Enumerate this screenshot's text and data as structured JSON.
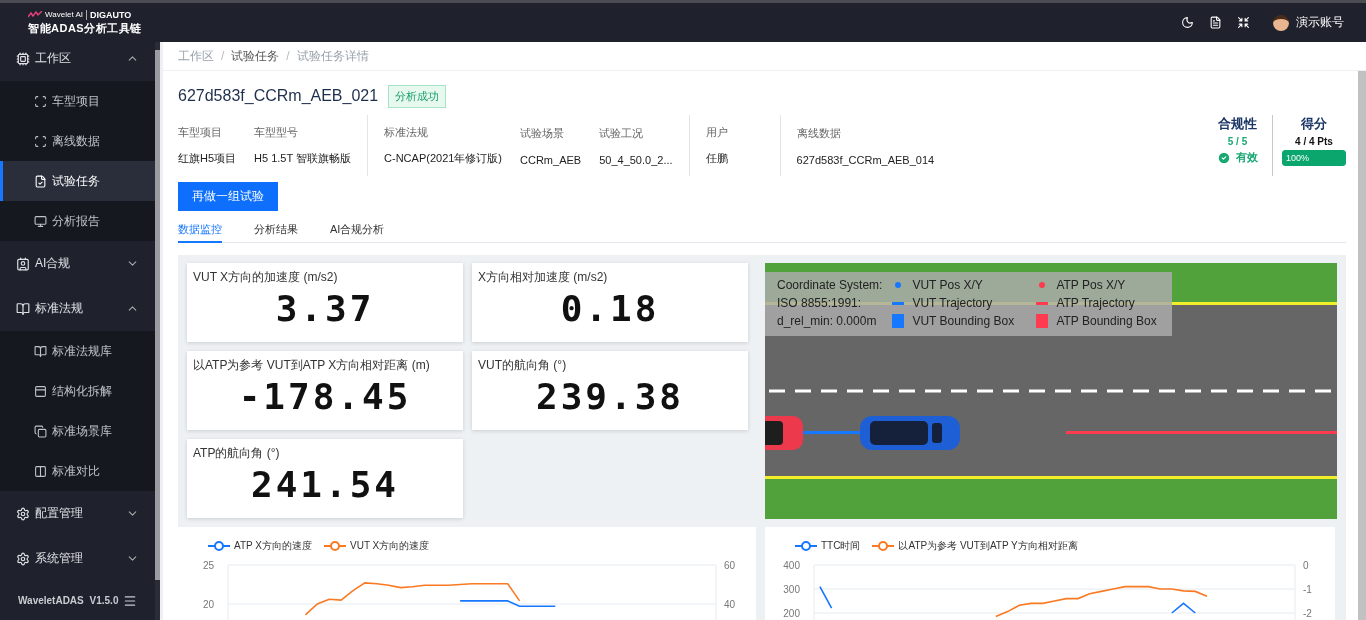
{
  "header": {
    "logo": {
      "brand": "Wavelet AI",
      "partner": "DIGAUTO",
      "subtitle": "智能ADAS分析工具链"
    },
    "user": "演示账号"
  },
  "sidebar": {
    "groups": [
      {
        "label": "工作区",
        "expanded": true,
        "children": [
          {
            "label": "车型项目",
            "selected": false
          },
          {
            "label": "离线数据",
            "selected": false
          },
          {
            "label": "试验任务",
            "selected": true
          },
          {
            "label": "分析报告",
            "selected": false
          }
        ]
      },
      {
        "label": "AI合规",
        "expanded": false
      },
      {
        "label": "标准法规",
        "expanded": true,
        "children": [
          {
            "label": "标准法规库",
            "selected": false
          },
          {
            "label": "结构化拆解",
            "selected": false
          },
          {
            "label": "标准场景库",
            "selected": false
          },
          {
            "label": "标准对比",
            "selected": false
          }
        ]
      },
      {
        "label": "配置管理",
        "expanded": false
      },
      {
        "label": "系统管理",
        "expanded": false
      }
    ],
    "version": "WaveletADAS V1.5.0"
  },
  "breadcrumb": {
    "separator": "/",
    "items": [
      "工作区",
      "试验任务",
      "试验任务详情"
    ]
  },
  "task": {
    "title": "627d583f_CCRm_AEB_021",
    "status": "分析成功",
    "field_groups": [
      [
        {
          "label": "车型项目",
          "value": "红旗H5项目"
        },
        {
          "label": "车型型号",
          "value": "H5 1.5T 智联旗畅版"
        }
      ],
      [
        {
          "label": "标准法规",
          "value": "C-NCAP(2021年修订版)"
        },
        {
          "label": "试验场景",
          "value": "CCRm_AEB"
        },
        {
          "label": "试验工况",
          "value": "50_4_50.0_2..."
        }
      ],
      [
        {
          "label": "用户",
          "value": "任鹏"
        }
      ],
      [
        {
          "label": "离线数据",
          "value": "627d583f_CCRm_AEB_014"
        }
      ]
    ],
    "action": "再做一组试验"
  },
  "compliance": {
    "title": "合规性",
    "count": "5 / 5",
    "status": "有效"
  },
  "score": {
    "title": "得分",
    "points": "4 / 4 Pts",
    "level": 1,
    "reading": "100%"
  },
  "tabs": [
    {
      "label": "数据监控",
      "selected": true
    },
    {
      "label": "分析结果",
      "selected": false
    },
    {
      "label": "AI合规分析",
      "selected": false
    }
  ],
  "gauges": [
    {
      "title": "VUT X方向的加速度 (m/s2)",
      "value": "3.37"
    },
    {
      "title": "X方向相对加速度 (m/s2)",
      "value": "0.18"
    },
    {
      "title": "以ATP为参考 VUT到ATP X方向相对距离 (m)",
      "value": "-178.45"
    },
    {
      "title": "VUT的航向角 (°)",
      "value": "239.38"
    },
    {
      "title": "ATP的航向角 (°)",
      "value": "241.54"
    }
  ],
  "scene": {
    "info": [
      "Coordinate System:",
      "ISO 8855:1991:",
      "d_rel_min: 0.000m"
    ],
    "legend": [
      {
        "kind": "point",
        "label": "VUT Pos X/Y",
        "color": "#1677ff"
      },
      {
        "kind": "point",
        "label": "ATP Pos X/Y",
        "color": "#ff3b4f"
      },
      {
        "kind": "line",
        "label": "VUT Trajectory",
        "color": "#1677ff"
      },
      {
        "kind": "line",
        "label": "ATP Trajectory",
        "color": "#ff3b4f"
      },
      {
        "kind": "box",
        "label": "VUT Bounding Box",
        "color": "#1677ff"
      },
      {
        "kind": "box",
        "label": "ATP Bounding Box",
        "color": "#ff3b4f"
      }
    ]
  },
  "charts": [
    {
      "chart_data": {
        "type": "line",
        "categories": [
          null,
          null,
          null,
          null,
          null,
          null,
          null,
          null,
          null,
          null,
          null,
          null,
          null,
          null,
          null,
          null,
          null,
          null,
          null,
          null,
          null,
          null,
          null,
          null,
          null,
          null,
          null,
          null,
          null,
          null,
          null,
          null,
          null,
          null,
          null,
          null,
          null,
          null,
          null,
          null,
          null
        ],
        "ylim": [
          17.95,
          25
        ],
        "yticks": [
          20,
          25
        ],
        "y2lim": [
          31.8,
          60
        ],
        "y2ticks": [
          40,
          60
        ],
        "series": [
          {
            "name": "ATP X方向的速度",
            "color": "#1677ff",
            "values": [
              null,
              null,
              null,
              null,
              null,
              null,
              null,
              null,
              null,
              null,
              null,
              null,
              null,
              null,
              null,
              null,
              null,
              null,
              null,
              20.4,
              20.4,
              20.4,
              20.4,
              20.4,
              19.7,
              19.7,
              19.7,
              19.7,
              null,
              null,
              null,
              null,
              null,
              null,
              null,
              null,
              null,
              null,
              null,
              null,
              null
            ]
          },
          {
            "name": "VUT X方向的速度",
            "color": "#fa7a23",
            "values": [
              null,
              null,
              null,
              null,
              null,
              null,
              18.6,
              20.0,
              20.6,
              20.5,
              21.7,
              22.7,
              22.6,
              22.4,
              22.1,
              22.2,
              22.4,
              22.4,
              22.4,
              22.5,
              22.6,
              22.6,
              22.6,
              22.6,
              20.4,
              null,
              null,
              null,
              null,
              null,
              null,
              null,
              null,
              null,
              null,
              null,
              null,
              null,
              null,
              null,
              null
            ]
          }
        ]
      }
    },
    {
      "chart_data": {
        "type": "line",
        "categories": [
          null,
          null,
          null,
          null,
          null,
          null,
          null,
          null,
          null,
          null,
          null,
          null,
          null,
          null,
          null,
          null,
          null,
          null,
          null,
          null,
          null,
          null,
          null,
          null,
          null,
          null,
          null,
          null,
          null,
          null,
          null,
          null,
          null,
          null,
          null,
          null,
          null,
          null,
          null,
          null,
          null
        ],
        "ylim": [
          171,
          400
        ],
        "yticks": [
          200,
          300,
          400
        ],
        "y2lim": [
          -2.29,
          0
        ],
        "y2ticks": [
          -2,
          -1,
          0
        ],
        "series": [
          {
            "name": "TTC时间",
            "color": "#1677ff",
            "values": [
              310,
              220,
              null,
              null,
              null,
              null,
              null,
              null,
              null,
              null,
              null,
              null,
              null,
              null,
              null,
              null,
              null,
              null,
              null,
              null,
              null,
              null,
              null,
              null,
              null,
              null,
              null,
              null,
              null,
              null,
              200,
              240,
              200,
              null,
              null,
              null,
              null,
              null,
              null,
              null,
              null
            ]
          },
          {
            "name": "以ATP为参考 VUT到ATP Y方向相对距离",
            "color": "#fa7a23",
            "axis": "y2",
            "values": [
              null,
              null,
              null,
              null,
              null,
              null,
              null,
              null,
              null,
              null,
              null,
              null,
              null,
              null,
              null,
              -2.15,
              -1.94,
              -1.68,
              -1.6,
              -1.6,
              -1.5,
              -1.4,
              -1.4,
              -1.2,
              -1.1,
              -1.0,
              -0.9,
              -0.9,
              -0.9,
              -1.0,
              -1.0,
              -1.08,
              -1.1,
              -1.3,
              null,
              null,
              null,
              null,
              null,
              null,
              null
            ]
          }
        ]
      }
    }
  ]
}
